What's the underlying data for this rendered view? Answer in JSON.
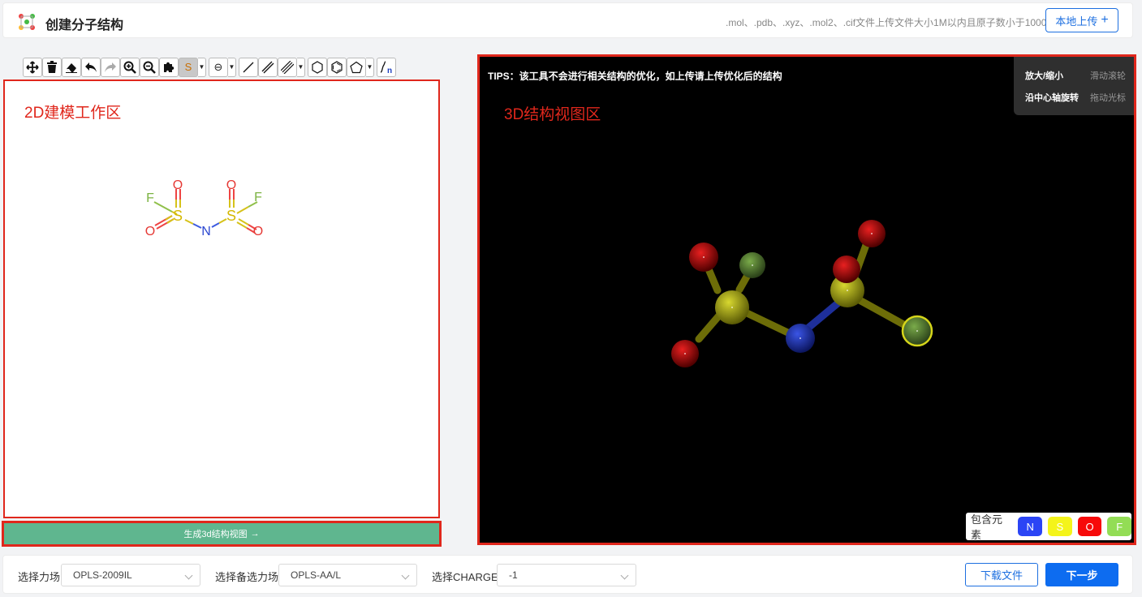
{
  "header": {
    "title": "创建分子结构",
    "upload_hint": ".mol、.pdb、.xyz、.mol2、.cif文件上传文件大小1M以内且原子数小于1000",
    "upload_label": "本地上传",
    "upload_icon": "plus-icon"
  },
  "toolbar": {
    "items": [
      {
        "name": "move",
        "icon": "move-icon"
      },
      {
        "name": "delete",
        "icon": "trash-icon"
      },
      {
        "name": "erase",
        "icon": "eraser-icon"
      },
      {
        "name": "undo",
        "icon": "undo-icon"
      },
      {
        "name": "redo",
        "icon": "redo-icon"
      },
      {
        "name": "zoom-in",
        "icon": "zoom-in-icon"
      },
      {
        "name": "zoom-out",
        "icon": "zoom-out-icon"
      },
      {
        "name": "template",
        "icon": "puzzle-icon"
      },
      {
        "name": "atom",
        "text": "S"
      },
      {
        "name": "charge",
        "text": "⊖"
      },
      {
        "name": "single-bond",
        "icon": "single-bond-icon"
      },
      {
        "name": "double-bond",
        "icon": "double-bond-icon"
      },
      {
        "name": "triple-bond",
        "icon": "triple-bond-icon"
      },
      {
        "name": "hexagon",
        "icon": "hexagon-icon"
      },
      {
        "name": "benzene",
        "icon": "benzene-icon"
      },
      {
        "name": "pentagon",
        "icon": "pentagon-icon"
      },
      {
        "name": "chain",
        "icon": "chain-icon"
      }
    ]
  },
  "workspace": {
    "label": "2D建模工作区",
    "atoms": {
      "F1": "F",
      "F2": "F",
      "S1": "S",
      "S2": "S",
      "O1": "O",
      "O2": "O",
      "O3": "O",
      "O4": "O",
      "N": "N"
    }
  },
  "generate_button": "生成3d结构视图",
  "viewer": {
    "tips": "TIPS：该工具不会进行相关结构的优化，如上传请上传优化后的结构",
    "label": "3D结构视图区",
    "help": [
      {
        "key": "放大/缩小",
        "value": "滑动滚轮"
      },
      {
        "key": "沿中心轴旋转",
        "value": "拖动光标"
      }
    ],
    "elements_label": "包含元素",
    "elements": [
      {
        "symbol": "N",
        "color": "#2b45f5"
      },
      {
        "symbol": "S",
        "color": "#f4f41a"
      },
      {
        "symbol": "O",
        "color": "#f70a0a"
      },
      {
        "symbol": "F",
        "color": "#93dd55"
      }
    ]
  },
  "footer": {
    "force_field_label": "选择力场",
    "force_field_value": "OPLS-2009IL",
    "alt_force_field_label": "选择备选力场",
    "alt_force_field_value": "OPLS-AA/L",
    "charge_label": "选择CHARGE",
    "charge_value": "-1",
    "download_label": "下载文件",
    "next_label": "下一步"
  }
}
